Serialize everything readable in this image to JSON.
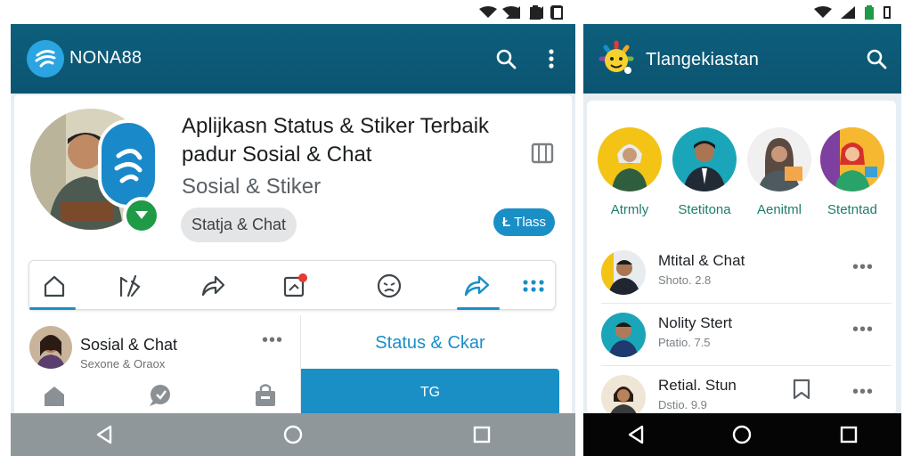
{
  "left_app": {
    "title": "NONA88",
    "headline_line1": "Aplijkasn Status & Stiker Terbaik",
    "headline_line2": "padur Sosial & Chat",
    "subheadline": "Sosial & Stiker",
    "chip_label": "Statja & Chat",
    "action_button_label": "Tlass",
    "action_button_glyph": "Ł",
    "tabs": [
      "home-icon",
      "tools-icon",
      "share-icon",
      "notification-icon",
      "emoji-icon",
      "forward-icon",
      "grid-icon"
    ],
    "list_item": {
      "name": "Sosial & Chat",
      "sub": "Sexone & Oraox"
    },
    "panel_title": "Status & Ckar",
    "panel_button": "TG",
    "bottom_icons": [
      "home-icon",
      "chat-icon",
      "bag-icon"
    ]
  },
  "right_app": {
    "title": "Tlangekiastan",
    "stories": [
      {
        "label": "Atrmly",
        "color": "#f3c316"
      },
      {
        "label": "Stetitona",
        "color": "#1aa6b8"
      },
      {
        "label": "Aenitml",
        "color": "#f0f0f0"
      },
      {
        "label": "Stetntad",
        "color": "#f5b828"
      }
    ],
    "chats": [
      {
        "name": "Mtital & Chat",
        "sub": "Shoto. 2.8"
      },
      {
        "name": "Nolity Stert",
        "sub": "Ptatio. 7.5"
      },
      {
        "name": "Retial. Stun",
        "sub": "Dstio. 9.9"
      }
    ]
  },
  "colors": {
    "appbar": "#0d5f7c",
    "accent": "#1a8fc6",
    "story_label": "#1e7d6a",
    "badge_green": "#1f9a47",
    "notification_dot": "#e53935"
  },
  "system_nav": [
    "back-icon",
    "home-circle-icon",
    "recents-icon"
  ]
}
